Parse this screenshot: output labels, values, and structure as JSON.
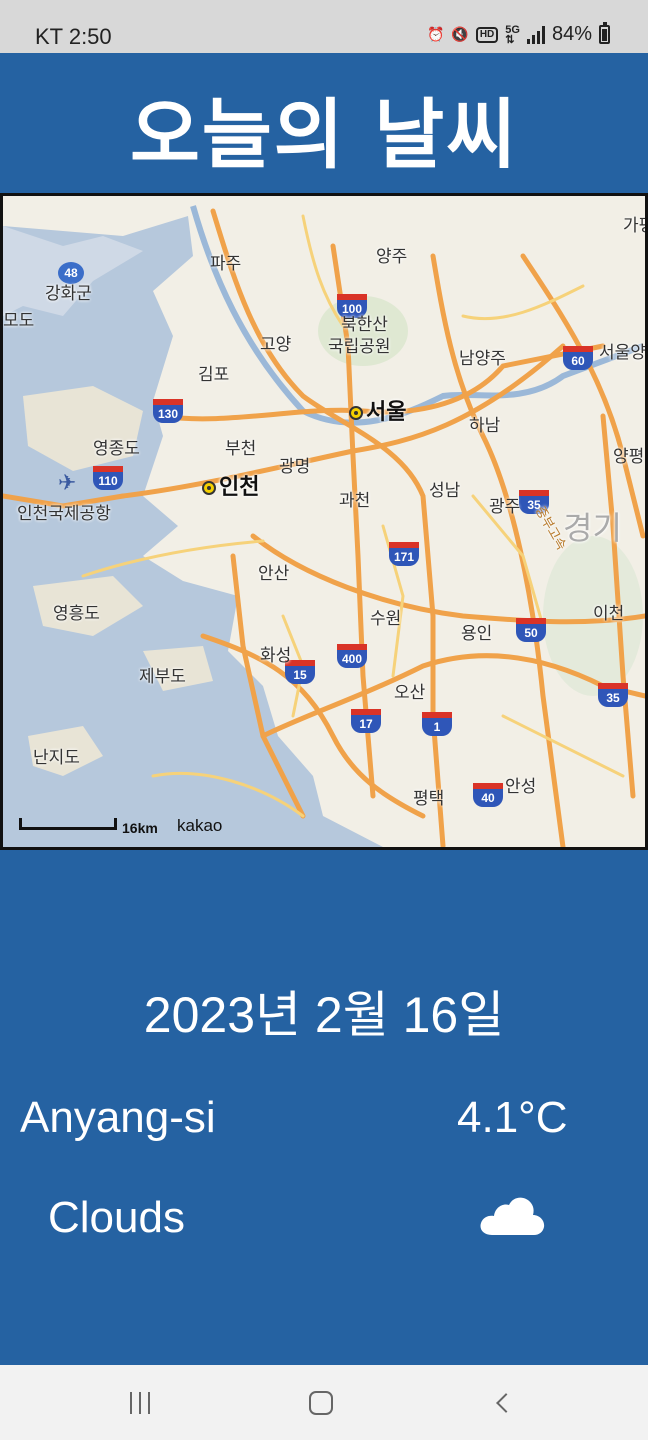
{
  "status_bar": {
    "carrier_time": "KT 2:50",
    "battery": "84%",
    "icons": [
      "alarm-icon",
      "mute-icon",
      "hd-icon",
      "5g-icon",
      "signal-icon",
      "battery-icon"
    ]
  },
  "header": {
    "title": "오늘의 날씨"
  },
  "map": {
    "labels": {
      "paju": "파주",
      "yangju": "양주",
      "gangwha": "강화군",
      "bukhansan": "북한산",
      "gungnip": "국립공원",
      "goyang": "고양",
      "namyangju": "남양주",
      "gimpo": "김포",
      "seoul": "서울",
      "hanam": "하남",
      "yeongjong": "영종도",
      "bucheon": "부천",
      "gwangmyeong": "광명",
      "incheon": "인천",
      "gwacheon": "과천",
      "seongnam": "성남",
      "gwangju": "광주",
      "gyeonggi": "경기",
      "airport": "인천국제공항",
      "ansan": "안산",
      "yeongheung": "영흥도",
      "suwon": "수원",
      "yongin": "용인",
      "icheon": "이천",
      "jebu": "제부도",
      "hwaseong": "화성",
      "osan": "오산",
      "nanji": "난지도",
      "pyeongtaek": "평택",
      "anseong": "안성",
      "yangpyeong": "양평",
      "gapyeong": "가평",
      "seoulyang": "서울양",
      "modo": "모도",
      "expressway": "중부고속"
    },
    "route_shields": [
      "48",
      "100",
      "130",
      "110",
      "60",
      "35",
      "171",
      "50",
      "400",
      "15",
      "17",
      "1",
      "35",
      "40"
    ],
    "scale": "16km",
    "attribution": "kakao"
  },
  "weather": {
    "date": "2023년 2월 16일",
    "city": "Anyang-si",
    "temperature": "4.1°C",
    "condition": "Clouds",
    "condition_icon": "cloud-icon"
  },
  "nav": {
    "icons": [
      "recents-icon",
      "home-icon",
      "back-icon"
    ]
  },
  "colors": {
    "background": "#2562a2",
    "status_bar": "#d8d8d8",
    "nav_bar": "#f2f2f2"
  }
}
